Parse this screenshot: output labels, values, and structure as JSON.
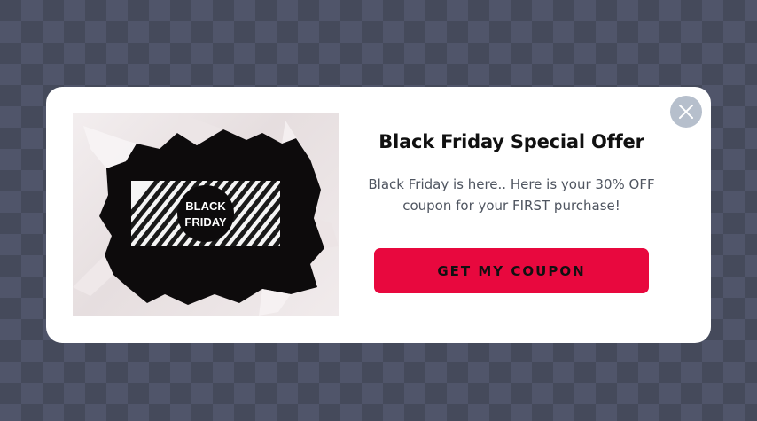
{
  "popup": {
    "title": "Black Friday Special Offer",
    "description": "Black Friday is here.. Here is your 30% OFF coupon for your FIRST purchase!",
    "cta_label": "GET MY COUPON",
    "close_icon": "close-icon",
    "image": {
      "badge_line1": "BLACK",
      "badge_line2": "FRIDAY"
    }
  },
  "colors": {
    "accent": "#e8083e",
    "overlay": "#454a5b",
    "close_button": "#b6bfcc",
    "modal_bg": "#ffffff"
  }
}
